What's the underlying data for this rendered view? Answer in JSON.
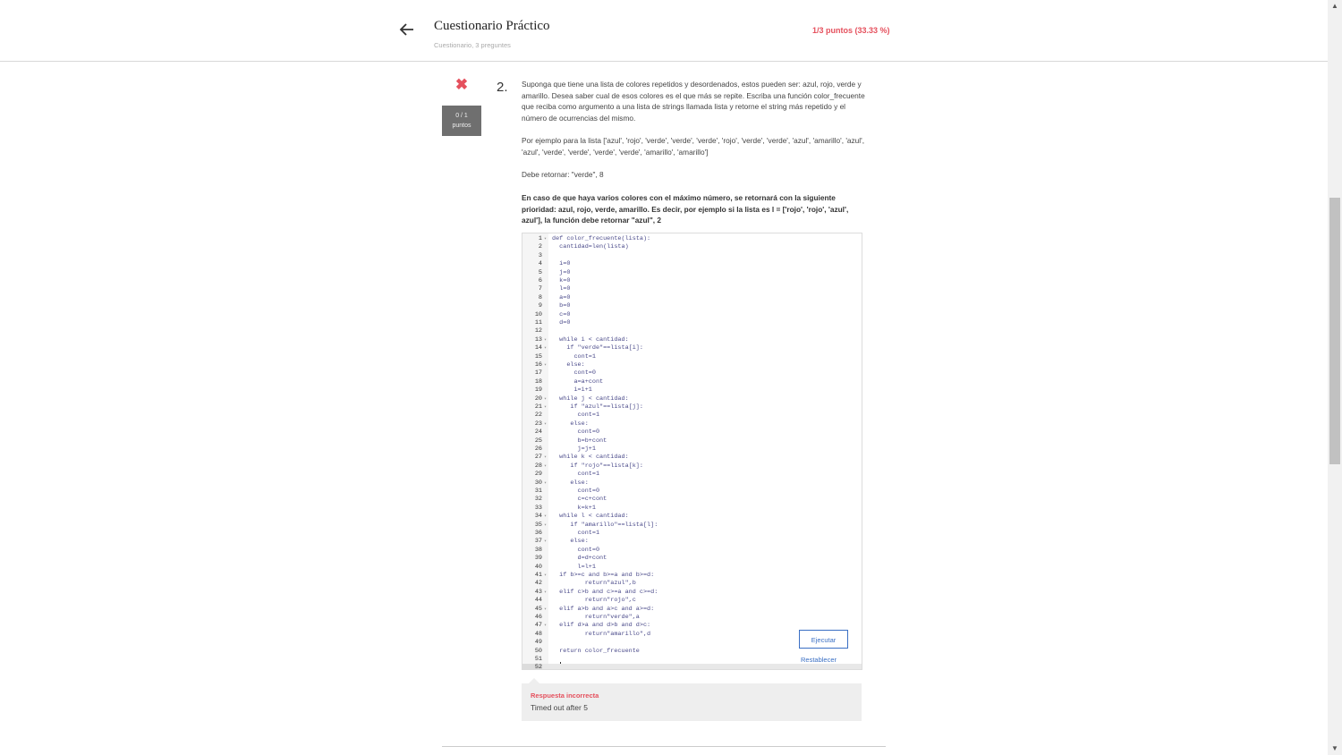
{
  "header": {
    "title": "Cuestionario Práctico",
    "subtitle": "Cuestionario, 3 preguntes",
    "score": "1/3 puntos (33.33 %)"
  },
  "question": {
    "status_icon": "close-icon",
    "points_value": "0 / 1",
    "points_label": "puntos",
    "number": "2.",
    "p1": "Suponga que tiene una lista de colores repetidos y desordenados, estos pueden ser: azul, rojo, verde y amarillo. Desea saber cual de esos colores es el que más se repite. Escriba una función color_frecuente que reciba como argumento a una lista de strings llamada lista y retorne el string más repetido y el número de ocurrencias del mismo.",
    "p2": "Por ejemplo para la lista ['azul', 'rojo', 'verde', 'verde', 'verde', 'rojo', 'verde', 'verde', 'azul', 'amarillo', 'azul', 'azul', 'verde', 'verde', 'verde', 'verde', 'amarillo', 'amarillo']",
    "p3": "Debe retornar: \"verde\", 8",
    "p4": "En caso de que haya varios colores con el máximo número, se retornará con la siguiente prioridad: azul, rojo, verde, amarillo. Es decir, por ejemplo si la lista es l = ['rojo', 'rojo', 'azul', azul'], la función debe retornar \"azul\", 2"
  },
  "editor": {
    "lines": [
      "def color_frecuente(lista):",
      "  cantidad=len(lista)",
      "",
      "  i=0",
      "  j=0",
      "  k=0",
      "  l=0",
      "  a=0",
      "  b=0",
      "  c=0",
      "  d=0",
      "",
      "  while i < cantidad:",
      "    if \"verde\"==lista[i]:",
      "      cont=1",
      "    else:",
      "      cont=0",
      "      a=a+cont",
      "      i=i+1",
      "  while j < cantidad:",
      "     if \"azul\"==lista[j]:",
      "       cont=1",
      "     else:",
      "       cont=0",
      "       b=b+cont",
      "       j=j+1",
      "  while k < cantidad:",
      "     if \"rojo\"==lista[k]:",
      "       cont=1",
      "     else:",
      "       cont=0",
      "       c=c+cont",
      "       k=k+1",
      "  while l < cantidad:",
      "     if \"amarillo\"==lista[l]:",
      "       cont=1",
      "     else:",
      "       cont=0",
      "       d=d+cont",
      "       l=l+1",
      "  if b>=c and b>=a and b>=d:",
      "         return\"azul\",b",
      "  elif c>b and c>=a and c>=d:",
      "         return\"rojo\",c",
      "  elif a>b and a>c and a>=d:",
      "         return\"verde\",a",
      "  elif d>a and d>b and d>c:",
      "         return\"amarillo\",d",
      "",
      "  return color_frecuente",
      "",
      ""
    ],
    "fold_lines": [
      1,
      13,
      14,
      16,
      20,
      21,
      23,
      27,
      28,
      30,
      34,
      35,
      37,
      41,
      43,
      45,
      47
    ],
    "run_label": "Ejecutar",
    "reset_label": "Restablecer"
  },
  "feedback": {
    "title": "Respuesta incorrecta",
    "message": "Timed out after 5"
  }
}
